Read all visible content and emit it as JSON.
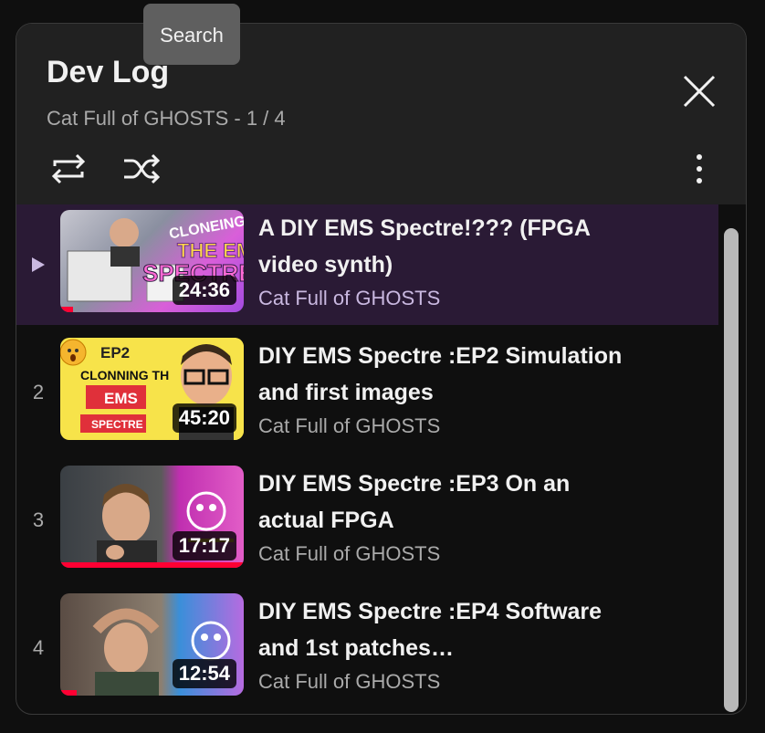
{
  "tooltip": {
    "text": "Search"
  },
  "playlist": {
    "title": "Dev Log",
    "subtitle": "Cat Full of GHOSTS - 1 / 4"
  },
  "icons": {
    "close": "close-icon",
    "loop": "loop-icon",
    "shuffle": "shuffle-icon",
    "more": "more-vertical-icon",
    "now_playing": "play-indicator-icon"
  },
  "colors": {
    "active_row_bg": "#2a1a35",
    "header_bg": "#212121",
    "background": "#0f0f0f",
    "progress_red": "#ff0033"
  },
  "videos": [
    {
      "index": "▶",
      "title": "A DIY EMS Spectre!??? (FPGA video synth)",
      "channel": "Cat Full of GHOSTS",
      "duration": "24:36",
      "active": true
    },
    {
      "index": "2",
      "title": "DIY EMS Spectre :EP2 Simulation and first images",
      "channel": "Cat Full of GHOSTS",
      "duration": "45:20",
      "active": false
    },
    {
      "index": "3",
      "title": "DIY EMS Spectre :EP3 On an actual FPGA",
      "channel": "Cat Full of GHOSTS",
      "duration": "17:17",
      "active": false
    },
    {
      "index": "4",
      "title": "DIY EMS Spectre :EP4 Software and 1st patches…",
      "channel": "Cat Full of GHOSTS",
      "duration": "12:54",
      "active": false
    }
  ],
  "thumb_text": {
    "t1_line1": "CLONEING",
    "t1_line2": "THE EMS",
    "t1_line3": "SPECTRE",
    "t2_line1": "EP2",
    "t2_line2": "CLONNING THE",
    "t2_line3": "EMS",
    "t2_line4": "SPECTRE"
  }
}
